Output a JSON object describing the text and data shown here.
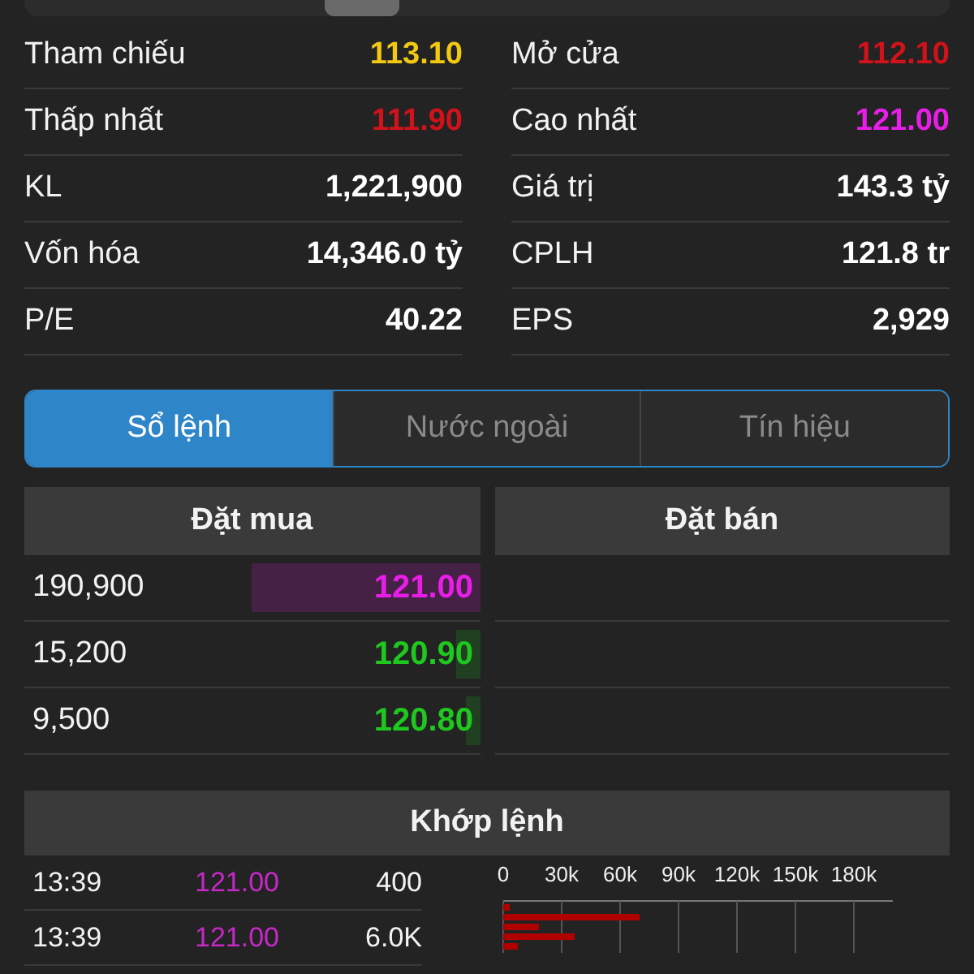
{
  "stats": [
    {
      "label": "Tham chiếu",
      "value": "113.10",
      "color": "#f2c811"
    },
    {
      "label": "Mở cửa",
      "value": "112.10",
      "color": "#d0121a"
    },
    {
      "label": "Thấp nhất",
      "value": "111.90",
      "color": "#d0121a"
    },
    {
      "label": "Cao nhất",
      "value": "121.00",
      "color": "#e81ee8"
    },
    {
      "label": "KL",
      "value": "1,221,900",
      "color": "#ffffff"
    },
    {
      "label": "Giá trị",
      "value": "143.3 tỷ",
      "color": "#ffffff"
    },
    {
      "label": "Vốn hóa",
      "value": "14,346.0 tỷ",
      "color": "#ffffff"
    },
    {
      "label": "CPLH",
      "value": "121.8 tr",
      "color": "#ffffff"
    },
    {
      "label": "P/E",
      "value": "40.22",
      "color": "#ffffff"
    },
    {
      "label": "EPS",
      "value": "2,929",
      "color": "#ffffff"
    }
  ],
  "tabs": [
    {
      "label": "Sổ lệnh",
      "selected": true
    },
    {
      "label": "Nước ngoài",
      "selected": false
    },
    {
      "label": "Tín hiệu",
      "selected": false
    }
  ],
  "order_book": {
    "bid_title": "Đặt mua",
    "ask_title": "Đặt bán",
    "bids": [
      {
        "volume": "190,900",
        "price": "121.00",
        "color": "#e81ee8",
        "level": 0.5
      },
      {
        "volume": "15,200",
        "price": "120.90",
        "color": "#1ec81e",
        "level": 0.05
      },
      {
        "volume": "9,500",
        "price": "120.80",
        "color": "#1ec81e",
        "level": 0.03
      }
    ]
  },
  "matched": {
    "title": "Khớp lệnh",
    "trades": [
      {
        "time": "13:39",
        "price": "121.00",
        "volume": "400",
        "color": "#c628c6"
      },
      {
        "time": "13:39",
        "price": "121.00",
        "volume": "6.0K",
        "color": "#c628c6"
      }
    ],
    "volume_axis_labels": [
      "0",
      "30k",
      "60k",
      "90k",
      "120k",
      "150k",
      "180k"
    ]
  }
}
